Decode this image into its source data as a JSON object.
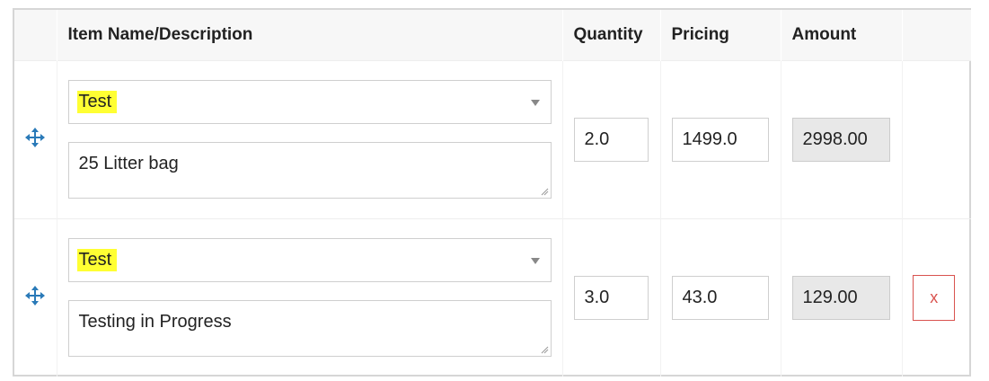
{
  "table": {
    "headers": {
      "item": "Item Name/Description",
      "quantity": "Quantity",
      "pricing": "Pricing",
      "amount": "Amount"
    },
    "rows": [
      {
        "item_name": "Test",
        "description": "25 Litter bag",
        "quantity": "2.0",
        "pricing": "1499.0",
        "amount": "2998.00",
        "has_remove": false
      },
      {
        "item_name": "Test",
        "description": "Testing in Progress",
        "quantity": "3.0",
        "pricing": "43.0",
        "amount": "129.00",
        "has_remove": true,
        "remove_label": "x"
      }
    ]
  },
  "icons": {
    "drag_handle": "move-arrows-icon",
    "select_caret": "chevron-down-icon",
    "resize": "resize-grip-icon"
  },
  "colors": {
    "highlight": "#ffff33",
    "drag_icon": "#2a7ab8",
    "remove": "#d9534f",
    "amount_bg": "#e8e8e8"
  }
}
